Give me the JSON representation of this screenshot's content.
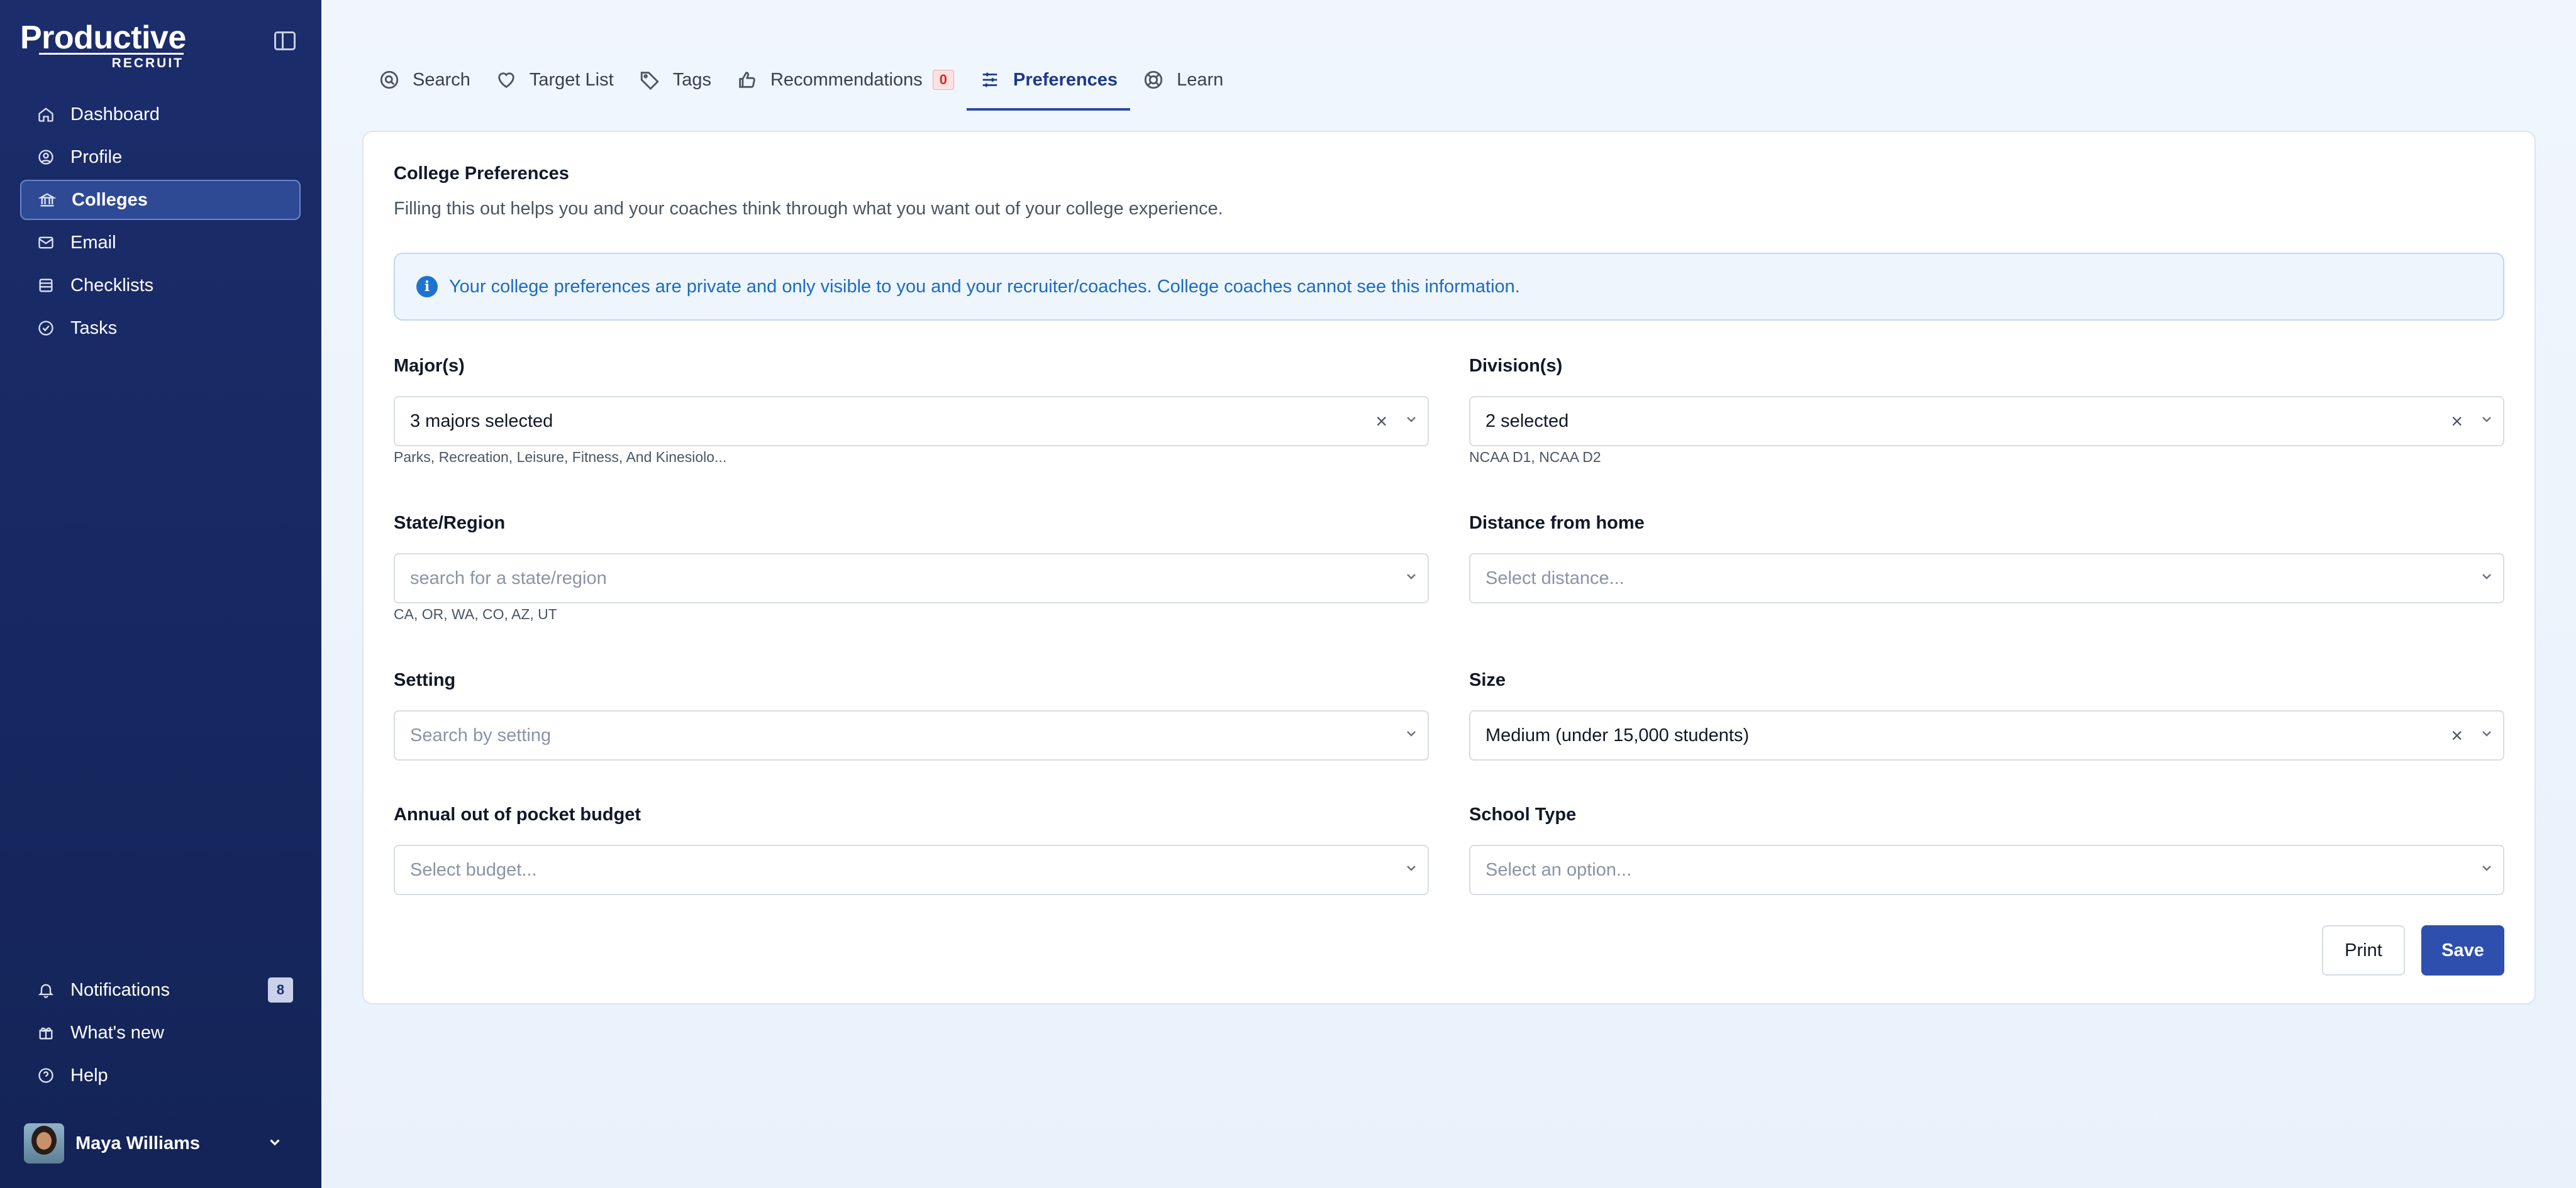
{
  "brand": {
    "name_main": "Productive",
    "name_sub": "RECRUIT"
  },
  "sidebar": {
    "items": [
      {
        "label": "Dashboard",
        "icon": "home-icon"
      },
      {
        "label": "Profile",
        "icon": "user-circle-icon"
      },
      {
        "label": "Colleges",
        "icon": "building-icon",
        "active": true
      },
      {
        "label": "Email",
        "icon": "mail-icon"
      },
      {
        "label": "Checklists",
        "icon": "list-icon"
      },
      {
        "label": "Tasks",
        "icon": "check-circle-icon"
      }
    ],
    "bottom": {
      "notifications_label": "Notifications",
      "notifications_count": "8",
      "whats_new_label": "What's new",
      "help_label": "Help"
    },
    "user": {
      "name": "Maya Williams"
    }
  },
  "tabs": [
    {
      "label": "Search",
      "icon": "search-icon"
    },
    {
      "label": "Target List",
      "icon": "heart-icon"
    },
    {
      "label": "Tags",
      "icon": "tag-icon"
    },
    {
      "label": "Recommendations",
      "icon": "thumbs-up-icon",
      "badge": "0"
    },
    {
      "label": "Preferences",
      "icon": "sliders-icon",
      "active": true
    },
    {
      "label": "Learn",
      "icon": "lifebuoy-icon"
    }
  ],
  "card": {
    "title": "College Preferences",
    "subtitle": "Filling this out helps you and your coaches think through what you want out of your college experience.",
    "info": "Your college preferences are private and only visible to you and your recruiter/coaches. College coaches cannot see this information."
  },
  "fields": {
    "majors": {
      "label": "Major(s)",
      "value": "3 majors selected",
      "hint": "Parks, Recreation, Leisure, Fitness, And Kinesiolo..."
    },
    "divisions": {
      "label": "Division(s)",
      "value": "2 selected",
      "hint": "NCAA D1, NCAA D2"
    },
    "state": {
      "label": "State/Region",
      "placeholder": "search for a state/region",
      "hint": "CA, OR, WA, CO, AZ, UT"
    },
    "distance": {
      "label": "Distance from home",
      "placeholder": "Select distance..."
    },
    "setting": {
      "label": "Setting",
      "placeholder": "Search by setting"
    },
    "size": {
      "label": "Size",
      "value": "Medium (under 15,000 students)"
    },
    "budget": {
      "label": "Annual out of pocket budget",
      "placeholder": "Select budget..."
    },
    "school_type": {
      "label": "School Type",
      "placeholder": "Select an option..."
    }
  },
  "buttons": {
    "print": "Print",
    "save": "Save"
  },
  "colors": {
    "sidebar": "#1b2d6b",
    "accent": "#2e4fae",
    "info_text": "#1a6bc4",
    "badge_red": "#dc2626"
  }
}
